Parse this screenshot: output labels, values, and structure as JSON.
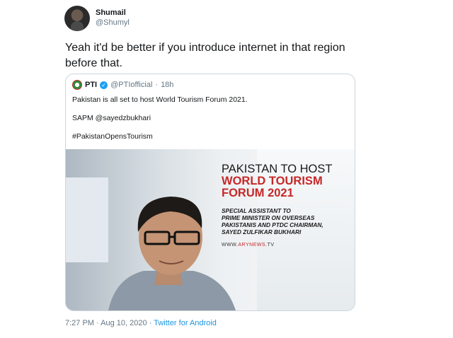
{
  "tweet": {
    "author_name": "Shumail",
    "author_handle": "@Shumyl",
    "text": "Yeah it'd be better if you introduce internet in that region before that."
  },
  "quoted_tweet": {
    "author_name": "PTI",
    "author_handle": "@PTIofficial",
    "separator": "·",
    "age": "18h",
    "lines": [
      "Pakistan is all set to host World Tourism Forum 2021.",
      "SAPM @sayedzbukhari",
      "#PakistanOpensTourism"
    ],
    "image": {
      "headline_line1": "PAKISTAN TO HOST",
      "headline_line2": "WORLD TOURISM",
      "headline_line3": "FORUM 2021",
      "subtitle_line1": "SPECIAL ASSISTANT TO",
      "subtitle_line2": "PRIME MINISTER ON OVERSEAS",
      "subtitle_line3": "PAKISTANIS AND PTDC CHAIRMAN,",
      "subtitle_line4": "SAYED ZULFIKAR BUKHARI",
      "website_prefix": "WWW.",
      "website_brand": "ARYNEWS",
      "website_suffix": ".TV"
    }
  },
  "footer": {
    "time": "7:27 PM",
    "separator1": "·",
    "date": "Aug 10, 2020",
    "separator2": "·",
    "source": "Twitter for Android"
  },
  "colors": {
    "link": "#1b95e0",
    "verified": "#1da1f2",
    "headline_red": "#c62828",
    "muted": "#657786"
  },
  "icons": [
    "avatar",
    "pti-logo-icon",
    "verified-badge-icon"
  ]
}
